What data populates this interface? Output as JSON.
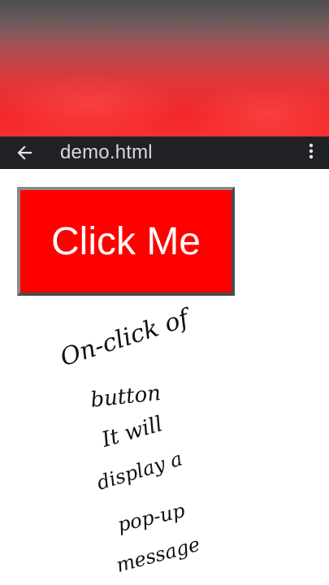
{
  "browser": {
    "title": "demo.html",
    "back_icon": "arrow-left-icon",
    "menu_icon": "more-vert-icon",
    "bar_color": "#202124"
  },
  "page": {
    "button_label": "Click Me",
    "button_color": "#ff0000",
    "note_lines": [
      "On-click of",
      "button",
      "It will",
      "display a",
      "pop-up",
      "message"
    ]
  }
}
